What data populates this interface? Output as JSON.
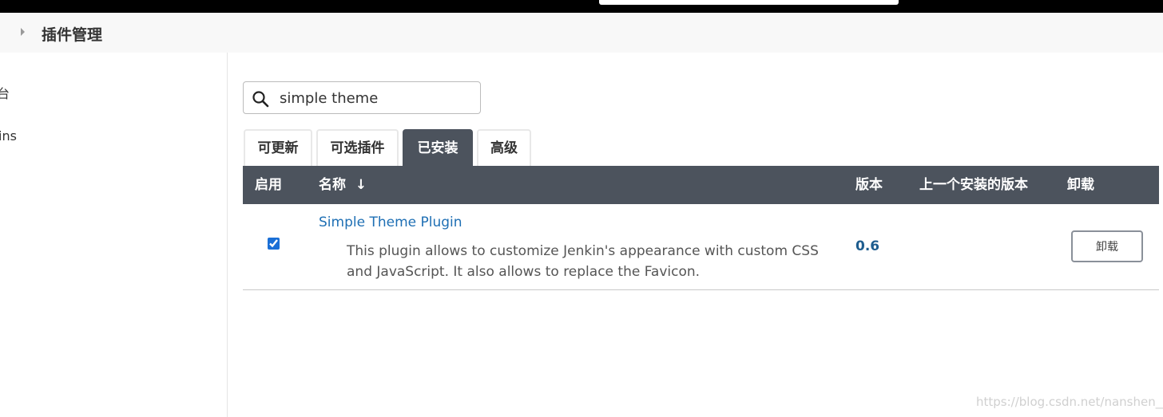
{
  "breadcrumb": {
    "title": "插件管理"
  },
  "sidebar": {
    "items": [
      {
        "label": "台"
      },
      {
        "label": "ins"
      }
    ]
  },
  "search": {
    "value": "simple theme"
  },
  "tabs": [
    {
      "label": "可更新"
    },
    {
      "label": "可选插件"
    },
    {
      "label": "已安装",
      "active": true
    },
    {
      "label": "高级"
    }
  ],
  "table": {
    "headers": {
      "enabled": "启用",
      "name": "名称",
      "sort_indicator": "↓",
      "version": "版本",
      "previous_version": "上一个安装的版本",
      "uninstall": "卸载"
    },
    "rows": [
      {
        "enabled": true,
        "name": "Simple Theme Plugin",
        "description": "This plugin allows to customize Jenkin's appearance with custom CSS and JavaScript. It also allows to replace the Favicon.",
        "version": "0.6",
        "previous_version": "",
        "uninstall_label": "卸载"
      }
    ]
  },
  "watermark": "https://blog.csdn.net/nanshen__",
  "colors": {
    "header_bg": "#4c535d",
    "link": "#1e6fb4",
    "version": "#1e5d8f"
  }
}
